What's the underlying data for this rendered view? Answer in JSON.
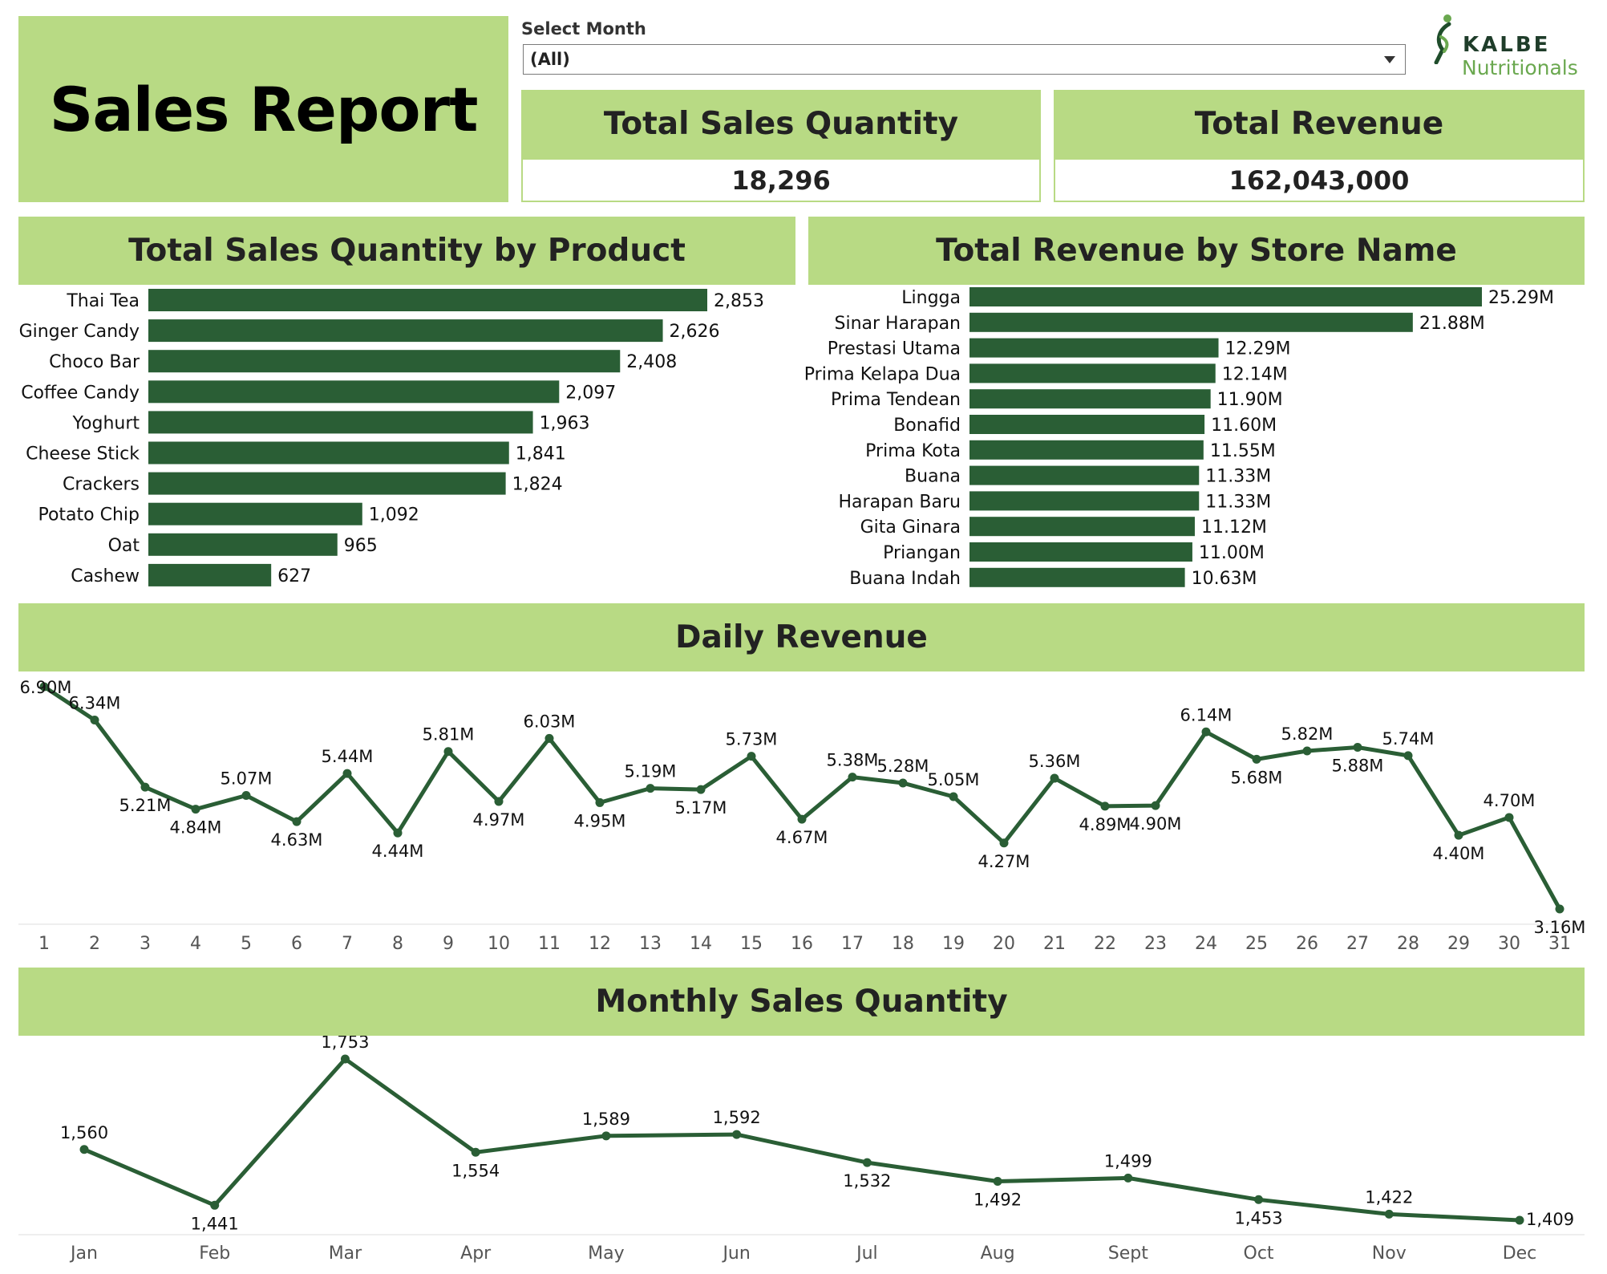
{
  "title": "Sales Report",
  "filter": {
    "label": "Select Month",
    "value": "(All)"
  },
  "logo": {
    "brand": "KALBE",
    "sub": "Nutritionals"
  },
  "kpis": {
    "quantity": {
      "label": "Total Sales Quantity",
      "value": "18,296"
    },
    "revenue": {
      "label": "Total Revenue",
      "value": "162,043,000"
    }
  },
  "colors": {
    "panel": "#b8da84",
    "bar": "#2a5e35",
    "line": "#2a5e35",
    "logo_green": "#6aa84f"
  },
  "chart_data": [
    {
      "type": "bar",
      "title": "Total Sales Quantity by Product",
      "orientation": "horizontal",
      "categories": [
        "Thai Tea",
        "Ginger Candy",
        "Choco Bar",
        "Coffee Candy",
        "Yoghurt",
        "Cheese Stick",
        "Crackers",
        "Potato Chip",
        "Oat",
        "Cashew"
      ],
      "values": [
        2853,
        2626,
        2408,
        2097,
        1963,
        1841,
        1824,
        1092,
        965,
        627
      ],
      "labels": [
        "2,853",
        "2,626",
        "2,408",
        "2,097",
        "1,963",
        "1,841",
        "1,824",
        "1,092",
        "965",
        "627"
      ]
    },
    {
      "type": "bar",
      "title": "Total Revenue by Store Name",
      "orientation": "horizontal",
      "categories": [
        "Lingga",
        "Sinar Harapan",
        "Prestasi Utama",
        "Prima Kelapa Dua",
        "Prima Tendean",
        "Bonafid",
        "Prima Kota",
        "Buana",
        "Harapan Baru",
        "Gita Ginara",
        "Priangan",
        "Buana Indah"
      ],
      "values": [
        25.29,
        21.88,
        12.29,
        12.14,
        11.9,
        11.6,
        11.55,
        11.33,
        11.33,
        11.12,
        11.0,
        10.63
      ],
      "labels": [
        "25.29M",
        "21.88M",
        "12.29M",
        "12.14M",
        "11.90M",
        "11.60M",
        "11.55M",
        "11.33M",
        "11.33M",
        "11.12M",
        "11.00M",
        "10.63M"
      ]
    },
    {
      "type": "line",
      "title": "Daily Revenue",
      "x": [
        "1",
        "2",
        "3",
        "4",
        "5",
        "6",
        "7",
        "8",
        "9",
        "10",
        "11",
        "12",
        "13",
        "14",
        "15",
        "16",
        "17",
        "18",
        "19",
        "20",
        "21",
        "22",
        "23",
        "24",
        "25",
        "26",
        "27",
        "28",
        "29",
        "30",
        "31"
      ],
      "values": [
        6.9,
        6.34,
        5.21,
        4.84,
        5.07,
        4.63,
        5.44,
        4.44,
        5.81,
        4.97,
        6.03,
        4.95,
        5.19,
        5.17,
        5.73,
        4.67,
        5.38,
        5.28,
        5.05,
        4.27,
        5.36,
        4.89,
        4.9,
        6.14,
        5.68,
        5.82,
        5.88,
        5.74,
        4.4,
        4.7,
        3.16
      ],
      "labels": [
        "6.90M",
        "6.34M",
        "5.21M",
        "4.84M",
        "5.07M",
        "4.63M",
        "5.44M",
        "4.44M",
        "5.81M",
        "4.97M",
        "6.03M",
        "4.95M",
        "5.19M",
        "5.17M",
        "5.73M",
        "4.67M",
        "5.38M",
        "5.28M",
        "5.05M",
        "4.27M",
        "5.36M",
        "4.89M",
        "4.90M",
        "6.14M",
        "5.68M",
        "5.82M",
        "5.88M",
        "5.74M",
        "4.40M",
        "4.70M",
        "3.16M"
      ],
      "label_pos": [
        "above",
        "above",
        "below",
        "below",
        "above",
        "below",
        "above",
        "below",
        "above",
        "below",
        "above",
        "below",
        "above",
        "below",
        "above",
        "below",
        "above",
        "above",
        "above",
        "below",
        "above",
        "below",
        "below",
        "above",
        "below",
        "above",
        "below",
        "above",
        "below",
        "above",
        "below"
      ],
      "ylim": [
        3.16,
        6.9
      ]
    },
    {
      "type": "line",
      "title": "Monthly Sales Quantity",
      "x": [
        "Jan",
        "Feb",
        "Mar",
        "Apr",
        "May",
        "Jun",
        "Jul",
        "Aug",
        "Sept",
        "Oct",
        "Nov",
        "Dec"
      ],
      "values": [
        1560,
        1441,
        1753,
        1554,
        1589,
        1592,
        1532,
        1492,
        1499,
        1453,
        1422,
        1409
      ],
      "labels": [
        "1,560",
        "1,441",
        "1,753",
        "1,554",
        "1,589",
        "1,592",
        "1,532",
        "1,492",
        "1,499",
        "1,453",
        "1,422",
        "1,409"
      ],
      "label_pos": [
        "above",
        "below",
        "above",
        "below",
        "above",
        "above",
        "below",
        "below",
        "above",
        "below",
        "above",
        "right"
      ],
      "ylim": [
        1409,
        1753
      ]
    }
  ]
}
